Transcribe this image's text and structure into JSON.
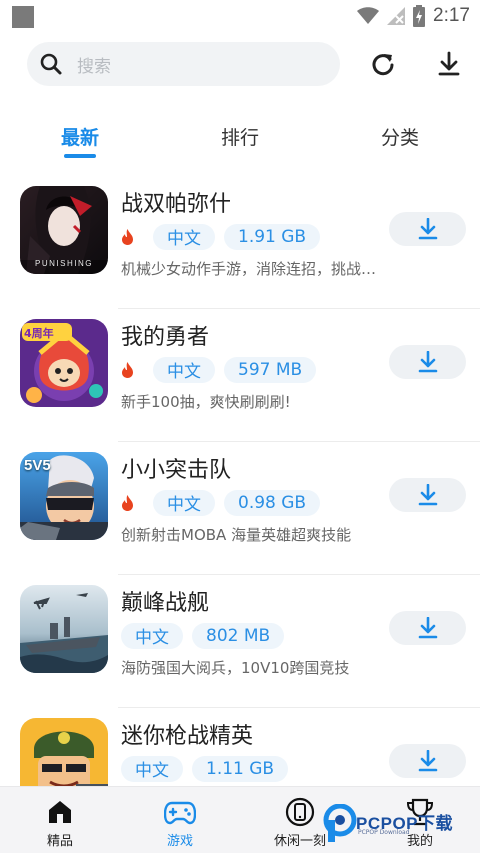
{
  "status_bar": {
    "time": "2:17"
  },
  "search": {
    "placeholder": "搜索"
  },
  "tabs": [
    {
      "label": "最新",
      "active": true
    },
    {
      "label": "排行",
      "active": false
    },
    {
      "label": "分类",
      "active": false
    }
  ],
  "apps": [
    {
      "name": "战双帕弥什",
      "hot": true,
      "language": "中文",
      "size": "1.91 GB",
      "description": "机械少女动作手游，消除连招，挑战极限",
      "icon_text": "PUNISHING"
    },
    {
      "name": "我的勇者",
      "hot": true,
      "language": "中文",
      "size": "597 MB",
      "description": "新手100抽，爽快刷刷刷!",
      "icon_text": "4周年"
    },
    {
      "name": "小小突击队",
      "hot": true,
      "language": "中文",
      "size": "0.98 GB",
      "description": "创新射击MOBA 海量英雄超爽技能",
      "icon_text": "5V5"
    },
    {
      "name": "巅峰战舰",
      "hot": false,
      "language": "中文",
      "size": "802 MB",
      "description": "海防强国大阅兵，10V10跨国竞技",
      "icon_text": ""
    },
    {
      "name": "迷你枪战精英",
      "hot": false,
      "language": "中文",
      "size": "1.11 GB",
      "description": "",
      "icon_text": ""
    }
  ],
  "bottom_nav": [
    {
      "label": "精品",
      "icon": "home-icon",
      "active": false
    },
    {
      "label": "游戏",
      "icon": "gamepad-icon",
      "active": true
    },
    {
      "label": "休闲一刻",
      "icon": "phone-icon",
      "active": false
    },
    {
      "label": "我的",
      "icon": "trophy-icon",
      "active": false
    }
  ],
  "watermark": {
    "text": "PCPOP下载",
    "sub": "PCPOP Download"
  },
  "colors": {
    "accent": "#1a8be8",
    "hot": "#e8431f",
    "pill_bg": "#eef5fb"
  }
}
